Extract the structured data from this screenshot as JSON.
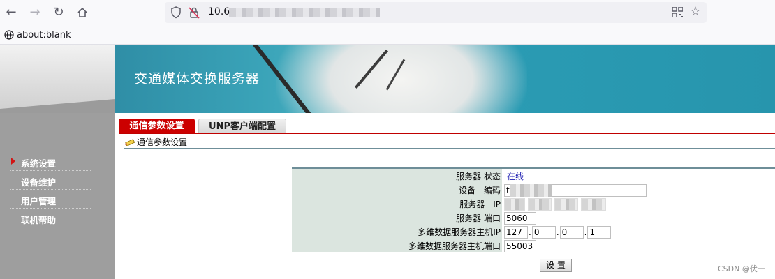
{
  "browser": {
    "url_prefix": "10.6",
    "tab_label": "about:blank"
  },
  "sidebar": {
    "items": [
      {
        "label": "系统设置",
        "active": true
      },
      {
        "label": "设备维护",
        "active": false
      },
      {
        "label": "用户管理",
        "active": false
      },
      {
        "label": "联机帮助",
        "active": false
      }
    ]
  },
  "banner": {
    "title": "交通媒体交换服务器"
  },
  "tabs": [
    {
      "label": "通信参数设置",
      "active": true
    },
    {
      "label": "UNP客户端配置",
      "active": false
    }
  ],
  "breadcrumb": {
    "label": "通信参数设置"
  },
  "form": {
    "rows": {
      "status": {
        "label": "服务器 状态",
        "value": "在线"
      },
      "code": {
        "label": "设备　编码",
        "value": "t"
      },
      "ip": {
        "label": "服务器　IP"
      },
      "port": {
        "label": "服务器 端口",
        "value": "5060"
      },
      "host_ip": {
        "label": "多维数据服务器主机IP",
        "octets": [
          "127",
          "0",
          "0",
          "1"
        ]
      },
      "host_port": {
        "label": "多维数据服务器主机端口",
        "value": "55003"
      }
    },
    "submit_label": "设 置"
  },
  "watermark": "CSDN @伏一",
  "colors": {
    "accent_red": "#cc0000",
    "banner_teal": "#2a9bb3",
    "sidebar_gray": "#9e9e9e",
    "label_bg": "#dbe5df",
    "status_blue": "#1a1ab0"
  }
}
